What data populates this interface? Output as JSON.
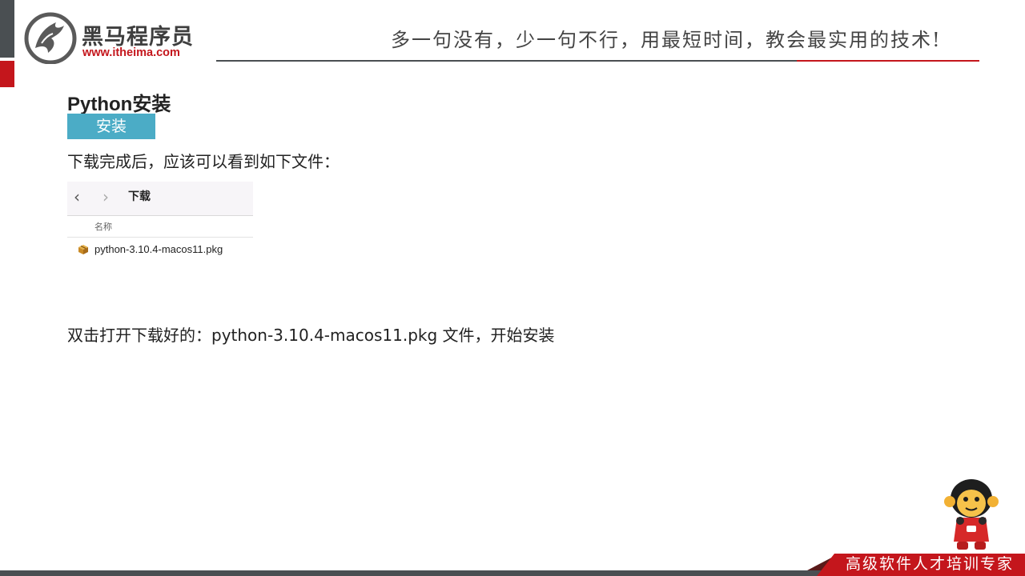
{
  "brand": {
    "name_cn": "黑马程序员",
    "url": "www.itheima.com",
    "slogan": "多一句没有，少一句不行，用最短时间，教会最实用的技术!",
    "footer_tagline": "高级软件人才培训专家"
  },
  "colors": {
    "accent_red": "#c4161c",
    "dark_gray": "#4a4f52",
    "tag_blue": "#4bacc6"
  },
  "content": {
    "title": "Python安装",
    "section_tag": "安装",
    "para_1": "下载完成后，应该可以看到如下文件：",
    "para_2": "双击打开下载好的：python-3.10.4-macos11.pkg 文件，开始安装"
  },
  "finder": {
    "back_icon": "chevron-left-icon",
    "forward_icon": "chevron-right-icon",
    "title": "下载",
    "column_header": "名称",
    "file_icon": "package-icon",
    "files": [
      "python-3.10.4-macos11.pkg"
    ]
  }
}
